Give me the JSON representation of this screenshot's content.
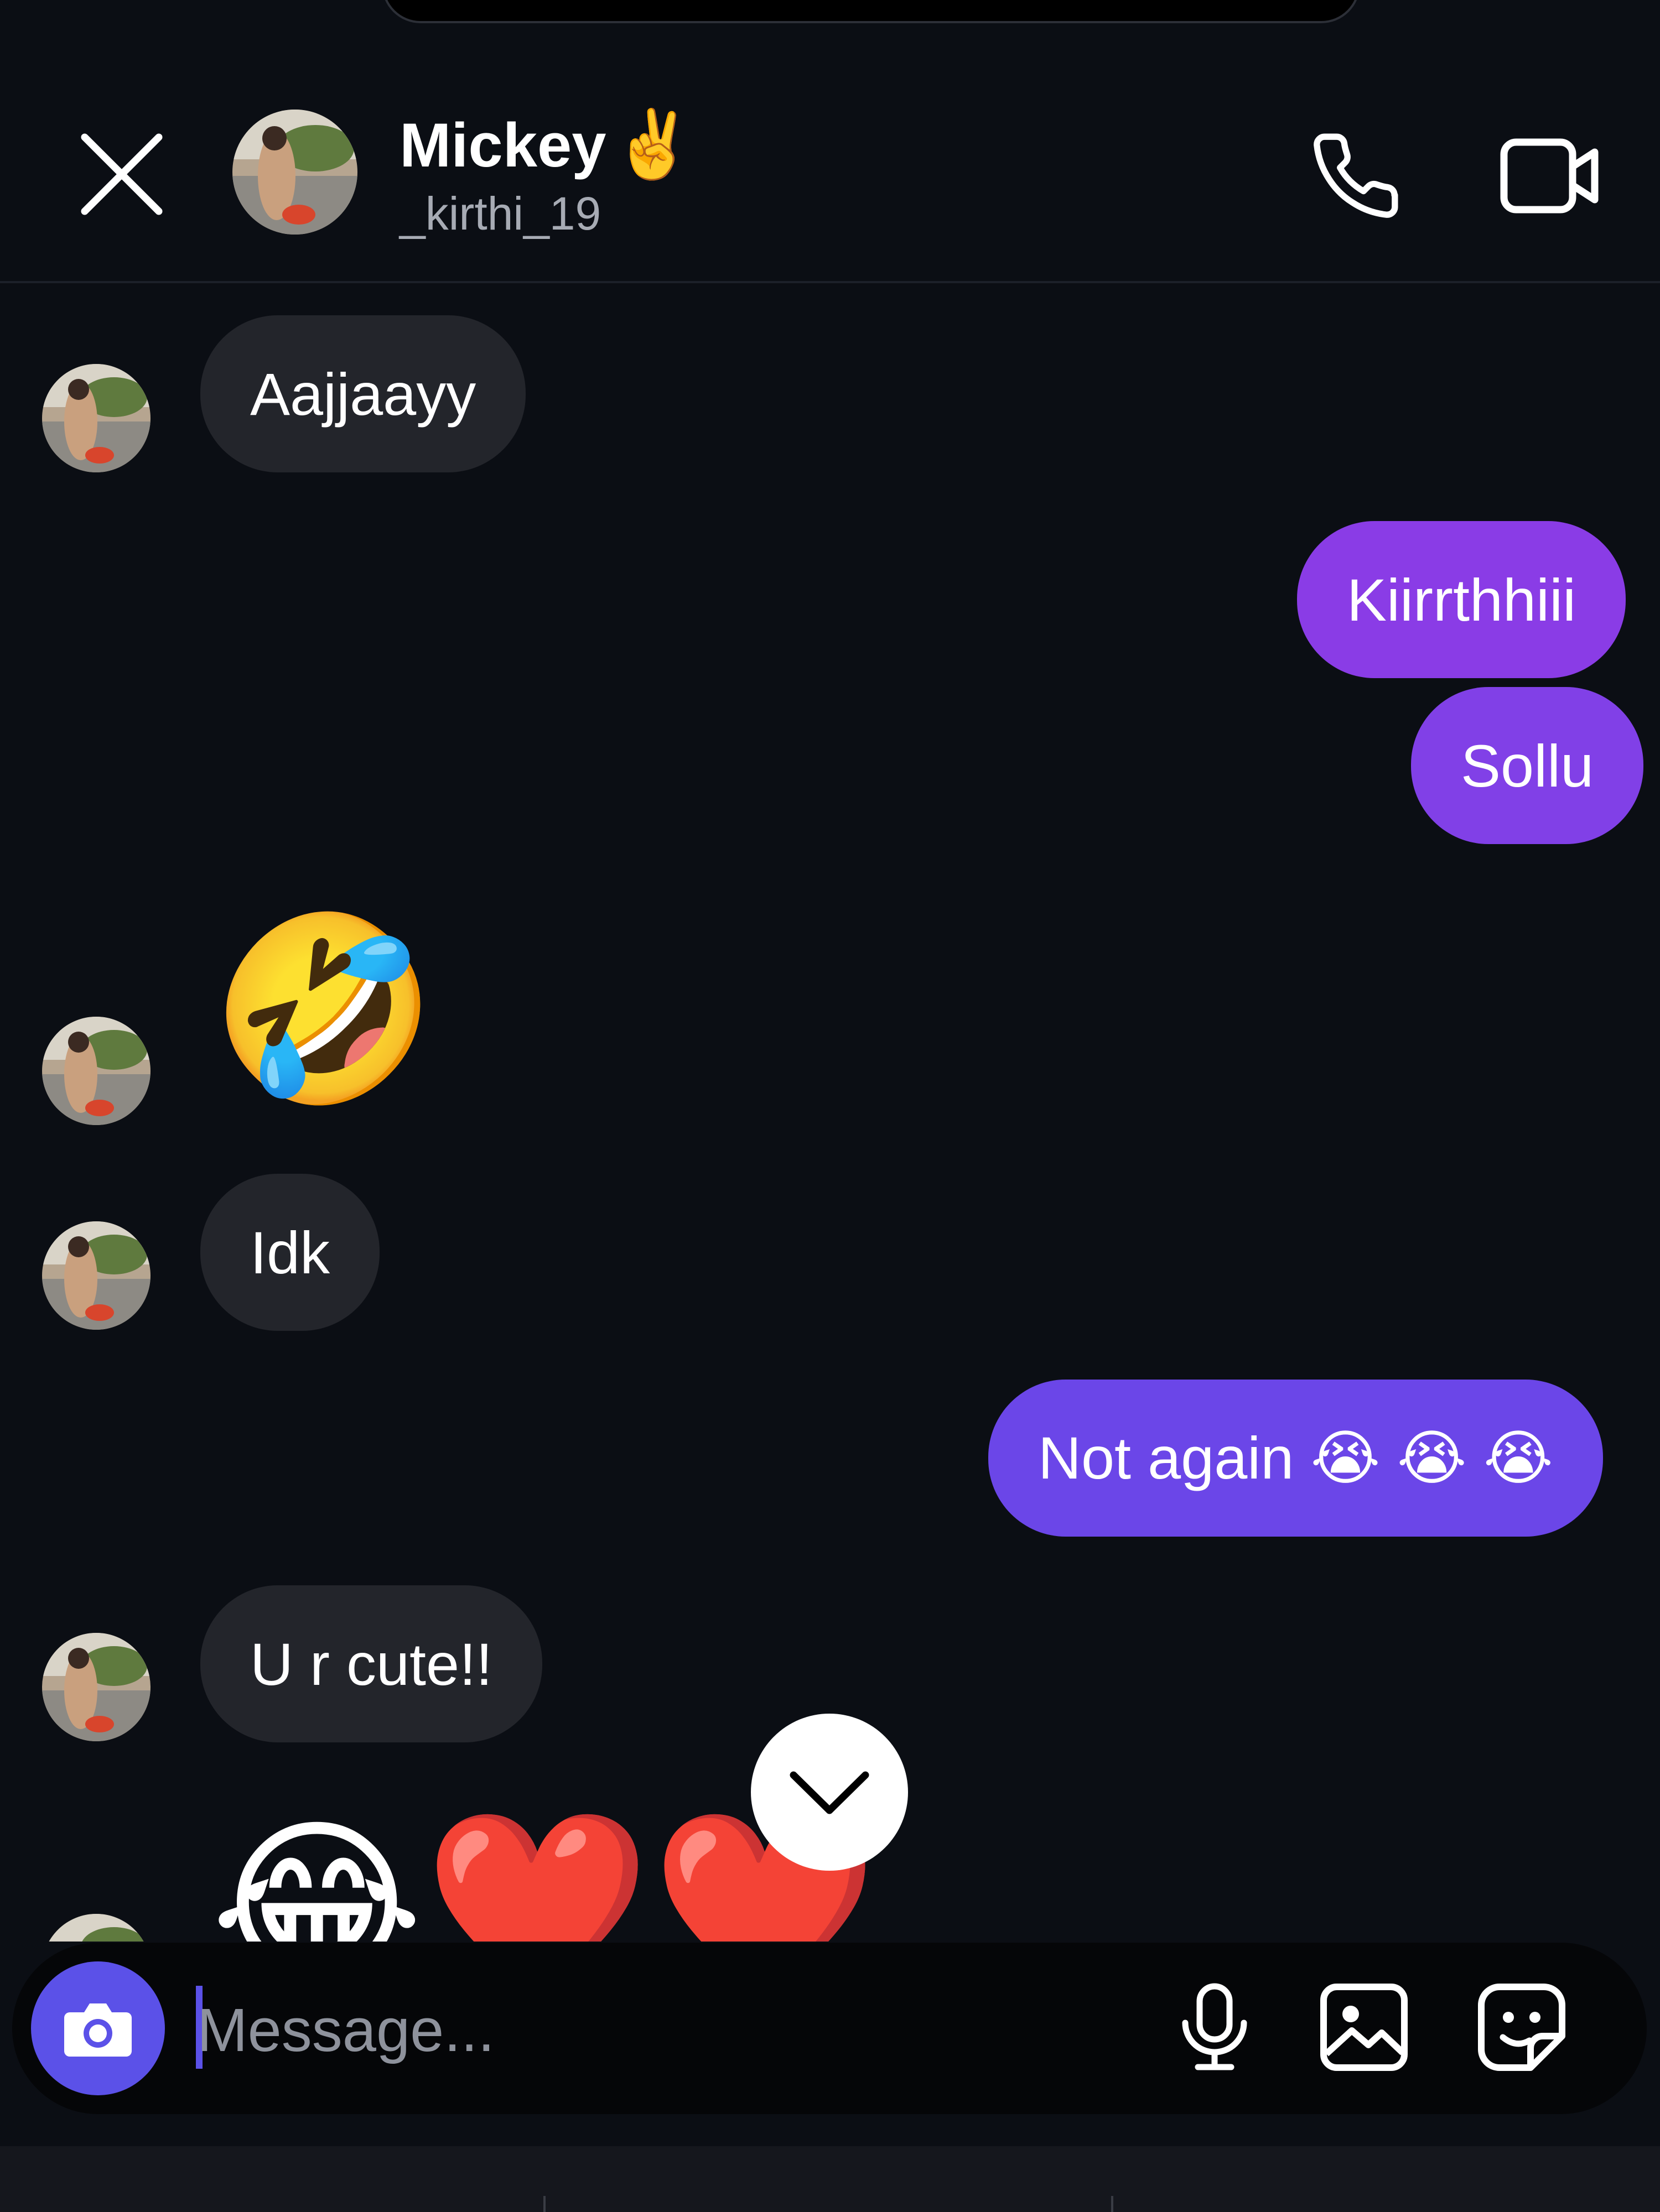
{
  "header": {
    "name": "Mickey",
    "name_emoji": "✌️",
    "handle": "_kirthi_19"
  },
  "messages": [
    {
      "from": "them",
      "text": "Aajjaayy"
    },
    {
      "from": "me",
      "text": "Kiirrthhiii"
    },
    {
      "from": "me",
      "text": "Sollu"
    },
    {
      "from": "them",
      "text": "🤣"
    },
    {
      "from": "them",
      "text": "Idk"
    },
    {
      "from": "me",
      "text": "Not again 😭 😭 😭"
    },
    {
      "from": "them",
      "text": "U r cute!!"
    },
    {
      "from": "them",
      "text": "😂❤️❤️"
    }
  ],
  "composer": {
    "placeholder": "Message..."
  },
  "colors": {
    "background": "#0b0e14",
    "incoming_bubble": "#23252b",
    "outgoing_bubble_top": "#8a3ce6",
    "outgoing_bubble_bottom": "#6b46e8",
    "camera_button": "#5b51e8"
  },
  "icons": [
    "close-icon",
    "phone-icon",
    "video-camera-icon",
    "chevron-down-icon",
    "camera-icon",
    "microphone-icon",
    "image-icon",
    "sticker-icon"
  ]
}
